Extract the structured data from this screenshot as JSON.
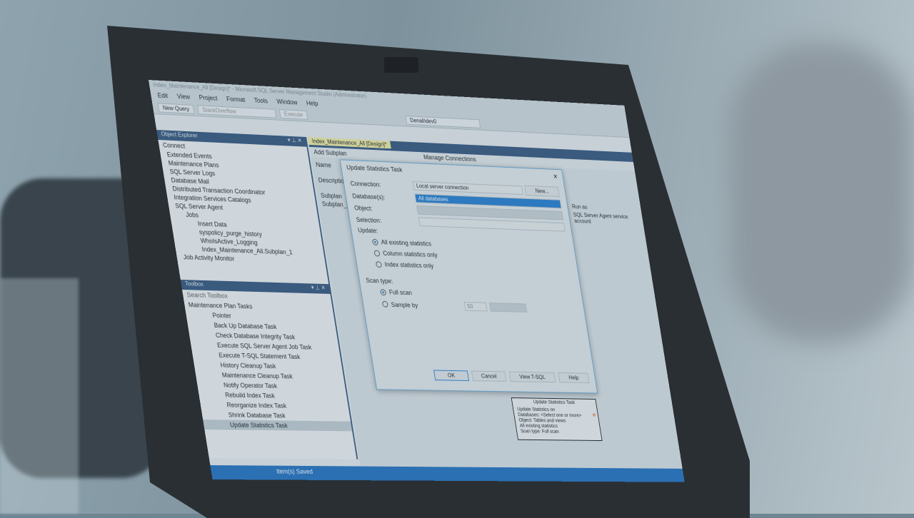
{
  "window_title": "Index_Maintenance_All [Design]* - Microsoft SQL Server Management Studio (Administrator)",
  "menu": [
    "Edit",
    "View",
    "Project",
    "Format",
    "Tools",
    "Window",
    "Help"
  ],
  "toolbar": {
    "new_query": "New Query",
    "database": "StackOverflow",
    "execute": "Execute",
    "config": "Denali\\dev0"
  },
  "object_explorer": {
    "title": "Object Explorer",
    "connect": "Connect",
    "items": [
      "Extended Events",
      "Maintenance Plans",
      "SQL Server Logs",
      "Database Mail",
      "Distributed Transaction Coordinator",
      "Integration Services Catalogs",
      "SQL Server Agent",
      "Jobs",
      "Insert Data",
      "syspolicy_purge_history",
      "WhoIsActive_Logging",
      "Index_Maintenance_All.Subplan_1",
      "Job Activity Monitor"
    ]
  },
  "toolbox": {
    "title": "Toolbox",
    "search_placeholder": "Search Toolbox",
    "group": "Maintenance Plan Tasks",
    "items": [
      "Pointer",
      "Back Up Database Task",
      "Check Database Integrity Task",
      "Execute SQL Server Agent Job Task",
      "Execute T-SQL Statement Task",
      "History Cleanup Task",
      "Maintenance Cleanup Task",
      "Notify Operator Task",
      "Rebuild Index Task",
      "Reorganize Index Task",
      "Shrink Database Task",
      "Update Statistics Task"
    ]
  },
  "designer": {
    "tab": "Index_Maintenance_All [Design]*",
    "add_subplan": "Add Subplan",
    "manage_connections": "Manage Connections",
    "name_label": "Name",
    "description_label": "Description",
    "subplan_header": "Subplan",
    "subplan_row": "Subplan_1",
    "runas_header": "Run as",
    "runas_value": "SQL Server Agent service account"
  },
  "dialog": {
    "title": "Update Statistics Task",
    "connection_label": "Connection:",
    "connection_value": "Local server connection",
    "new_button": "New...",
    "databases_label": "Database(s):",
    "databases_value": "All databases",
    "object_label": "Object:",
    "selection_label": "Selection:",
    "update_label": "Update:",
    "update_options": [
      "All existing statistics",
      "Column statistics only",
      "Index statistics only"
    ],
    "scan_label": "Scan type:",
    "scan_options": [
      "Full scan",
      "Sample by"
    ],
    "sample_value": "50",
    "ok": "OK",
    "cancel": "Cancel",
    "view_tsql": "View T-SQL",
    "help": "Help"
  },
  "task_box": {
    "title": "Update Statistics Task",
    "lines": [
      "Update Statistics on",
      "Databases: <Select one or more>",
      "Object: Tables and views",
      "All existing statistics",
      "Scan type: Full scan"
    ]
  },
  "status": "Item(s) Saved"
}
